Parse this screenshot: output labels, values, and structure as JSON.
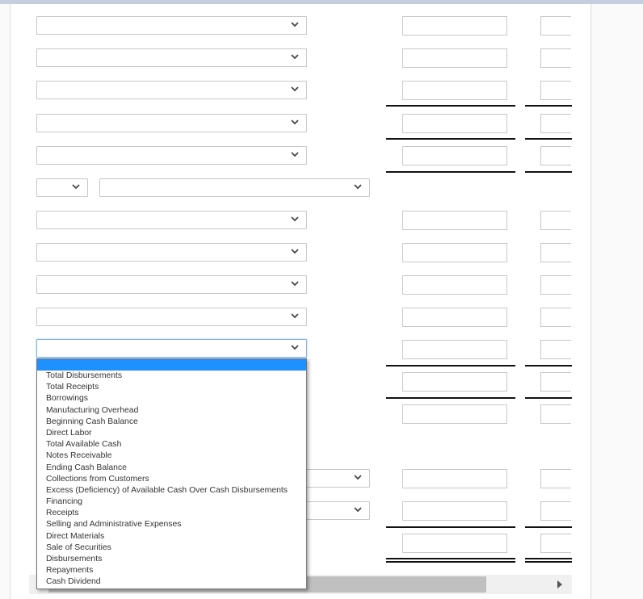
{
  "form": {
    "rows": [
      {
        "label_select": "",
        "col1": "",
        "col2": ""
      },
      {
        "label_select": "",
        "col1": "",
        "col2": ""
      },
      {
        "label_select": "",
        "col1": "",
        "col2": ""
      },
      {
        "label_select": "",
        "col1": "",
        "col2": ""
      },
      {
        "label_select": "",
        "col1": "",
        "col2": ""
      },
      {
        "prefix_select": "",
        "separator": ":",
        "label_select": ""
      },
      {
        "label_select": "",
        "col1": "",
        "col2": ""
      },
      {
        "label_select": "",
        "col1": "",
        "col2": ""
      },
      {
        "label_select": "",
        "col1": "",
        "col2": ""
      },
      {
        "label_select": "",
        "col1": "",
        "col2": ""
      },
      {
        "label_select": "",
        "col1": "",
        "col2": ""
      },
      {
        "col1": "",
        "col2": ""
      },
      {
        "col1": "",
        "col2": ""
      },
      {
        "label_select": "",
        "col1": "",
        "col2": ""
      },
      {
        "label_select": "",
        "col1": "",
        "col2": ""
      },
      {
        "currency_symbol": "$",
        "col1": "",
        "col2": ""
      }
    ]
  },
  "dropdown": {
    "selected": "",
    "options": [
      "Total Disbursements",
      "Total Receipts",
      "Borrowings",
      "Manufacturing Overhead",
      "Beginning Cash Balance",
      "Direct Labor",
      "Total Available Cash",
      "Notes Receivable",
      "Ending Cash Balance",
      "Collections from Customers",
      "Excess (Deficiency) of Available Cash Over Cash Disbursements",
      "Financing",
      "Receipts",
      "Selling and Administrative Expenses",
      "Direct Materials",
      "Sale of Securities",
      "Disbursements",
      "Repayments",
      "Cash Dividend"
    ]
  },
  "colors": {
    "highlight": "#1e90ff",
    "topbar": "#c4cedf"
  }
}
